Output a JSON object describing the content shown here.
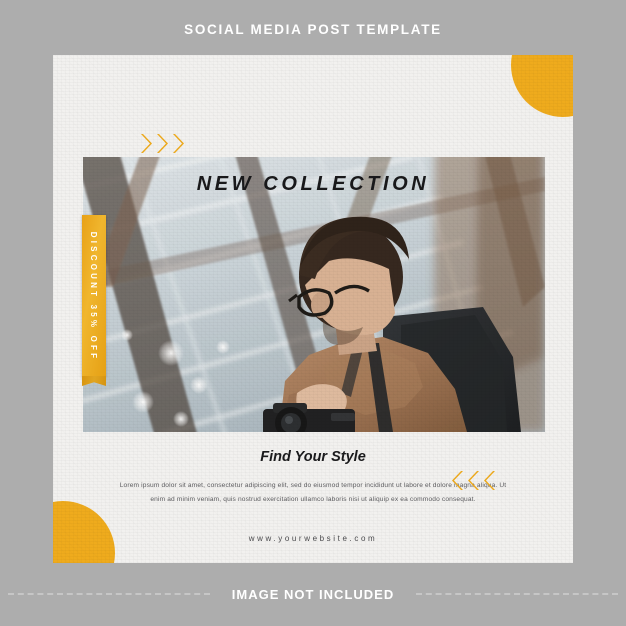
{
  "page": {
    "background_color": "#adadad",
    "accent_color": "#efab1d",
    "card_color": "#f2f1ef"
  },
  "header": {
    "title": "SOCIAL MEDIA POST TEMPLATE"
  },
  "card": {
    "headline": "NEW COLLECTION",
    "subhead": "Find Your Style",
    "body": "Lorem ipsum dolor sit amet, consectetur adipiscing elit, sed do eiusmod tempor incididunt ut labore et dolore magna aliqua. Ut enim ad minim veniam, quis nostrud exercitation ullamco laboris nisi ut aliquip ex ea commodo consequat.",
    "website": "www.yourwebsite.com",
    "ribbon": {
      "text": "DISCOUNT 35% OFF",
      "discount_value": "35%",
      "color": "#efab1d"
    },
    "photo": {
      "alt": "Man with glasses and backpack holding a camera under a glass roof",
      "caption": ""
    },
    "decorations": {
      "chevron_top_left": "›››",
      "chevron_bottom_right": "‹‹‹",
      "corner_top_right": "quarter-circle",
      "corner_bottom_left": "quarter-circle"
    }
  },
  "footer": {
    "notice": "IMAGE NOT INCLUDED"
  }
}
